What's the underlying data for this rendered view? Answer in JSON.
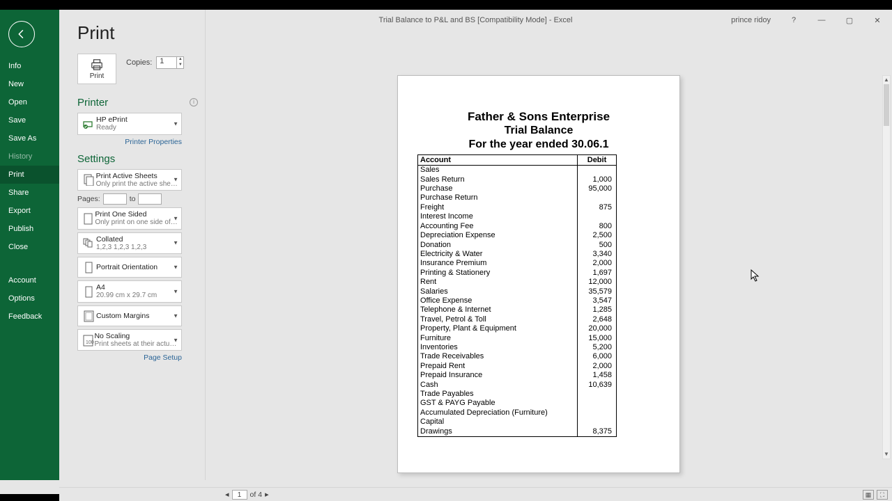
{
  "titlebar": {
    "title": "Trial Balance to P&L and BS  [Compatibility Mode] - Excel",
    "user": "prince ridoy"
  },
  "sidebar": {
    "items": [
      "Info",
      "New",
      "Open",
      "Save",
      "Save As",
      "History",
      "Print",
      "Share",
      "Export",
      "Publish",
      "Close"
    ],
    "items2": [
      "Account",
      "Options",
      "Feedback"
    ],
    "active": "Print",
    "dim": "History"
  },
  "print": {
    "title": "Print",
    "button": "Print",
    "copies_label": "Copies:",
    "copies": "1"
  },
  "printer": {
    "heading": "Printer",
    "name": "HP ePrint",
    "status": "Ready",
    "props_link": "Printer Properties"
  },
  "settings": {
    "heading": "Settings",
    "page_setup": "Page Setup",
    "pages_label": "Pages:",
    "pages_to": "to",
    "dds": [
      {
        "icon": "sheets",
        "t1": "Print Active Sheets",
        "t2": "Only print the active sheets"
      },
      {
        "pages": true
      },
      {
        "icon": "page",
        "t1": "Print One Sided",
        "t2": "Only print on one side of th…"
      },
      {
        "icon": "collate",
        "t1": "Collated",
        "t2": "1,2,3   1,2,3   1,2,3"
      },
      {
        "icon": "portrait",
        "t1": "Portrait Orientation",
        "t2": ""
      },
      {
        "icon": "a4",
        "t1": "A4",
        "t2": "20.99 cm x 29.7 cm"
      },
      {
        "icon": "margins",
        "t1": "Custom Margins",
        "t2": ""
      },
      {
        "icon": "scale",
        "t1": "No Scaling",
        "t2": "Print sheets at their actual size"
      }
    ]
  },
  "preview": {
    "h1": "Father & Sons Enterprise",
    "h2": "Trial Balance",
    "h3": "For the year ended 30.06.1",
    "col_account": "Account",
    "col_debit": "Debit",
    "rows": [
      {
        "a": "Sales",
        "d": ""
      },
      {
        "a": "Sales Return",
        "d": "1,000"
      },
      {
        "a": "Purchase",
        "d": "95,000"
      },
      {
        "a": "Purchase Return",
        "d": ""
      },
      {
        "a": "Freight",
        "d": "875"
      },
      {
        "a": "Interest Income",
        "d": ""
      },
      {
        "a": "Accounting Fee",
        "d": "800"
      },
      {
        "a": "Depreciation Expense",
        "d": "2,500"
      },
      {
        "a": "Donation",
        "d": "500"
      },
      {
        "a": "Electricity & Water",
        "d": "3,340"
      },
      {
        "a": "Insurance Premium",
        "d": "2,000"
      },
      {
        "a": "Printing & Stationery",
        "d": "1,697"
      },
      {
        "a": "Rent",
        "d": "12,000"
      },
      {
        "a": "Salaries",
        "d": "35,579"
      },
      {
        "a": "Office Expense",
        "d": "3,547"
      },
      {
        "a": "Telephone & Internet",
        "d": "1,285"
      },
      {
        "a": "Travel, Petrol & Toll",
        "d": "2,648"
      },
      {
        "a": "Property, Plant & Equipment",
        "d": "20,000"
      },
      {
        "a": "Furniture",
        "d": "15,000"
      },
      {
        "a": "Inventories",
        "d": "5,200"
      },
      {
        "a": "Trade Receivables",
        "d": "6,000"
      },
      {
        "a": "Prepaid Rent",
        "d": "2,000"
      },
      {
        "a": "Prepaid Insurance",
        "d": "1,458"
      },
      {
        "a": "Cash",
        "d": "10,639"
      },
      {
        "a": "Trade Payables",
        "d": ""
      },
      {
        "a": "GST & PAYG Payable",
        "d": ""
      },
      {
        "a": "Accumulated Depreciation (Furniture)",
        "d": ""
      },
      {
        "a": "Capital",
        "d": ""
      },
      {
        "a": "Drawings",
        "d": "8,375"
      }
    ]
  },
  "footer": {
    "page": "1",
    "of": "of",
    "total": "4"
  }
}
